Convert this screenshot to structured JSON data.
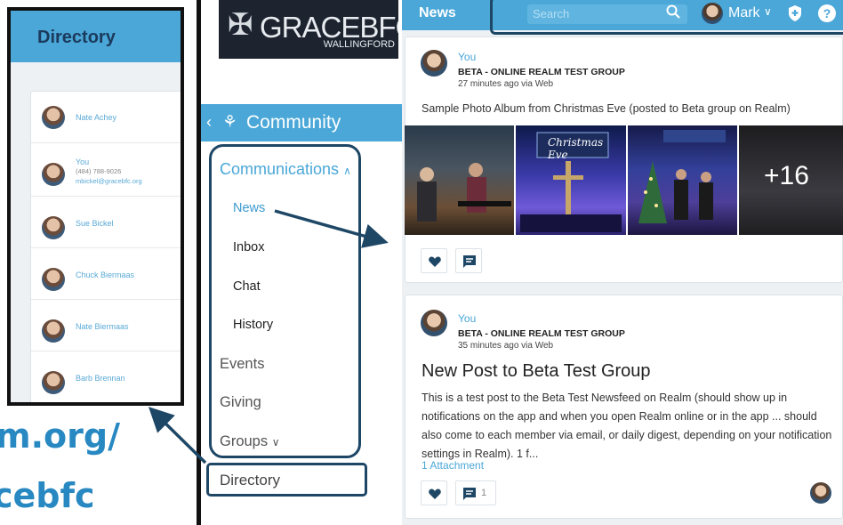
{
  "phone": {
    "title": "Directory",
    "contacts": [
      {
        "name": "Nate Achey"
      },
      {
        "name": "You",
        "phone": "(484) 788-9026",
        "email": "mbickel@gracebfc.org"
      },
      {
        "name": "Sue Bickel"
      },
      {
        "name": "Chuck Biermaas"
      },
      {
        "name": "Nate Biermaas"
      },
      {
        "name": "Barb Brennan"
      }
    ]
  },
  "url_fragments": [
    "m.org/",
    "cebfc"
  ],
  "logo": {
    "name": "GRACEBFC",
    "sub": "WALLINGFORD"
  },
  "nav": {
    "community": "Community",
    "communications": "Communications",
    "news": "News",
    "inbox": "Inbox",
    "chat": "Chat",
    "history": "History",
    "events": "Events",
    "giving": "Giving",
    "groups": "Groups",
    "directory": "Directory"
  },
  "header": {
    "title": "News",
    "search_placeholder": "Search",
    "user_name": "Mark"
  },
  "posts": [
    {
      "author": "You",
      "group": "BETA - ONLINE REALM TEST GROUP",
      "time": "27 minutes ago via Web",
      "text": "Sample Photo Album from Christmas Eve (posted to Beta group on Realm)",
      "more_photos": "+16",
      "photo_caption": "Christmas Eve"
    },
    {
      "author": "You",
      "group": "BETA - ONLINE REALM TEST GROUP",
      "time": "35 minutes ago via Web",
      "title": "New Post to Beta Test Group",
      "text": "This is a test post to the Beta Test Newsfeed on Realm (should show up in notifications on the app and when you open Realm online or in the app ... should also come to each member via email, or daily digest, depending on your notification settings in Realm).  1 f...",
      "attachments": "1 Attachment",
      "comment_count": "1"
    }
  ],
  "colors": {
    "accent": "#4aa7d8",
    "outline": "#1e4766",
    "url": "#2788c2"
  }
}
